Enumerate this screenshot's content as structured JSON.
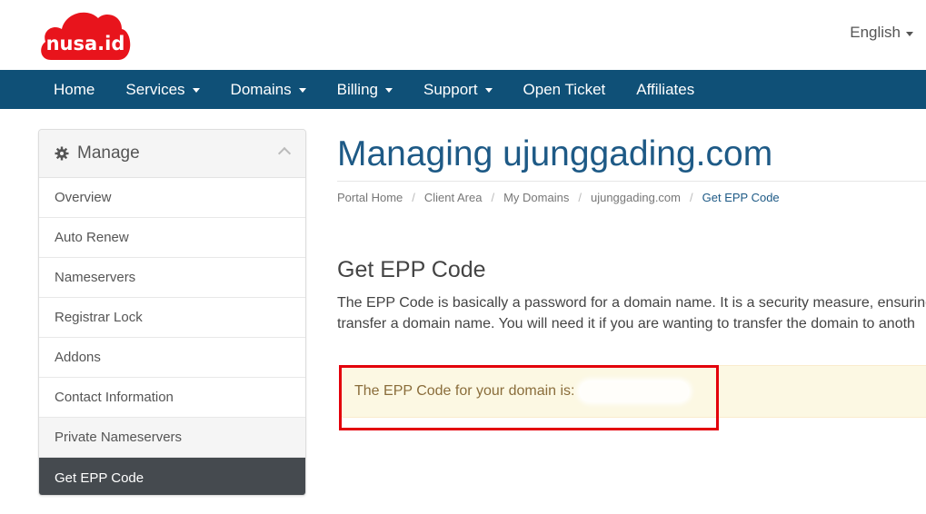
{
  "header": {
    "logo_text": "nusa.id",
    "language": "English"
  },
  "nav": {
    "items": [
      {
        "label": "Home",
        "dropdown": false
      },
      {
        "label": "Services",
        "dropdown": true
      },
      {
        "label": "Domains",
        "dropdown": true
      },
      {
        "label": "Billing",
        "dropdown": true
      },
      {
        "label": "Support",
        "dropdown": true
      },
      {
        "label": "Open Ticket",
        "dropdown": false
      },
      {
        "label": "Affiliates",
        "dropdown": false
      }
    ]
  },
  "sidebar": {
    "title": "Manage",
    "icon": "gear-icon",
    "items": [
      {
        "label": "Overview"
      },
      {
        "label": "Auto Renew"
      },
      {
        "label": "Nameservers"
      },
      {
        "label": "Registrar Lock"
      },
      {
        "label": "Addons"
      },
      {
        "label": "Contact Information"
      },
      {
        "label": "Private Nameservers"
      },
      {
        "label": "Get EPP Code"
      }
    ]
  },
  "main": {
    "title": "Managing ujunggading.com",
    "breadcrumb": [
      "Portal Home",
      "Client Area",
      "My Domains",
      "ujunggading.com",
      "Get EPP Code"
    ],
    "section_title": "Get EPP Code",
    "description_line1": "The EPP Code is basically a password for a domain name. It is a security measure, ensuring",
    "description_line2": "transfer a domain name. You will need it if you are wanting to transfer the domain to anoth",
    "alert_text": "The EPP Code for your domain is:"
  },
  "colors": {
    "brand_red": "#e8141c",
    "nav_bg": "#0f5077",
    "title_blue": "#1e5a86",
    "active_item_bg": "#454a4f",
    "alert_bg": "#fcf8e3",
    "alert_text": "#8a6d3b",
    "highlight_border": "#e3000b"
  }
}
